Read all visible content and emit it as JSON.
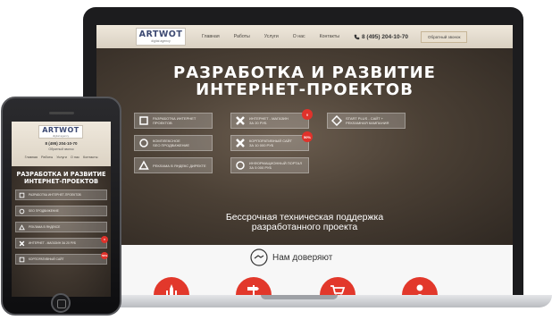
{
  "site": {
    "logo": "ARTWOT",
    "logo_tagline": "digital agency",
    "nav": [
      "Главная",
      "Работы",
      "Услуги",
      "О нас",
      "Контакты"
    ],
    "phone": "8 (495) 204-10-70",
    "callback": "Обратный звонок"
  },
  "hero": {
    "title_line1": "РАЗРАБОТКА И РАЗВИТИЕ",
    "title_line2": "ИНТЕРНЕТ-ПРОЕКТОВ",
    "subtitle_line1": "Бессрочная техническая поддержка",
    "subtitle_line2": "разработанного проекта"
  },
  "services": [
    {
      "icon": "square-icon",
      "label1": "РАЗРАБОТКА ИНТЕРНЕТ",
      "label2": "ПРОЕКТОВ",
      "badge": ""
    },
    {
      "icon": "close-icon",
      "label1": "ИНТЕРНЕТ - МАГАЗИН",
      "label2": "ЗА 20 РУБ",
      "badge": "!!"
    },
    {
      "icon": "diamond-icon",
      "label1": "START PLUS - САЙТ +",
      "label2": "РЕКЛАМНАЯ КАМПАНИЯ",
      "badge": ""
    },
    {
      "icon": "circle-icon",
      "label1": "КОМПЛЕКСНОЕ",
      "label2": "SEO ПРОДВИЖЕНИЕ",
      "badge": ""
    },
    {
      "icon": "close-icon",
      "label1": "КОРПОРАТИВНЫЙ САЙТ",
      "label2": "ЗА 10 000 РУБ",
      "badge": "50%"
    },
    {
      "icon": "triangle-icon",
      "label1": "РЕКЛАМА В ЯНДЕКС ДИРЕКТЕ",
      "label2": "",
      "badge": ""
    },
    {
      "icon": "circle-icon",
      "label1": "ИНФОРМАЦИОННЫЙ ПОРТАЛ",
      "label2": "ЗА 5 000 РУБ",
      "badge": ""
    }
  ],
  "trust": {
    "title": "Нам доверяют",
    "clients": [
      "kremlin-icon",
      "signpost-icon",
      "shopping-cart-icon",
      "person-icon"
    ]
  },
  "mobile": {
    "title_line1": "РАЗРАБОТКА И РАЗВИТИЕ",
    "title_line2": "ИНТЕРНЕТ-ПРОЕКТОВ",
    "phone": "8 (495) 204-10-70",
    "callback": "Обратный звонок",
    "nav": [
      "Главная",
      "Работы",
      "Услуги",
      "О нас",
      "Контакты"
    ],
    "services": [
      {
        "icon": "square-icon",
        "label": "РАЗРАБОТКА ИНТЕРНЕТ-ПРОЕКТОВ",
        "badge": ""
      },
      {
        "icon": "circle-icon",
        "label": "SEO ПРОДВИЖЕНИЕ",
        "badge": ""
      },
      {
        "icon": "triangle-icon",
        "label": "РЕКЛАМА В ЯНДЕКСЕ",
        "badge": ""
      },
      {
        "icon": "close-icon",
        "label": "ИНТЕРНЕТ - МАГАЗИН ЗА 20 РУБ",
        "badge": "!!"
      },
      {
        "icon": "square-icon",
        "label": "КОРПОРАТИВНЫЙ САЙТ",
        "badge": "50%"
      }
    ]
  },
  "colors": {
    "accent": "#e2382b",
    "logo": "#3d4a73",
    "header_bg": "#e6ddd0"
  }
}
